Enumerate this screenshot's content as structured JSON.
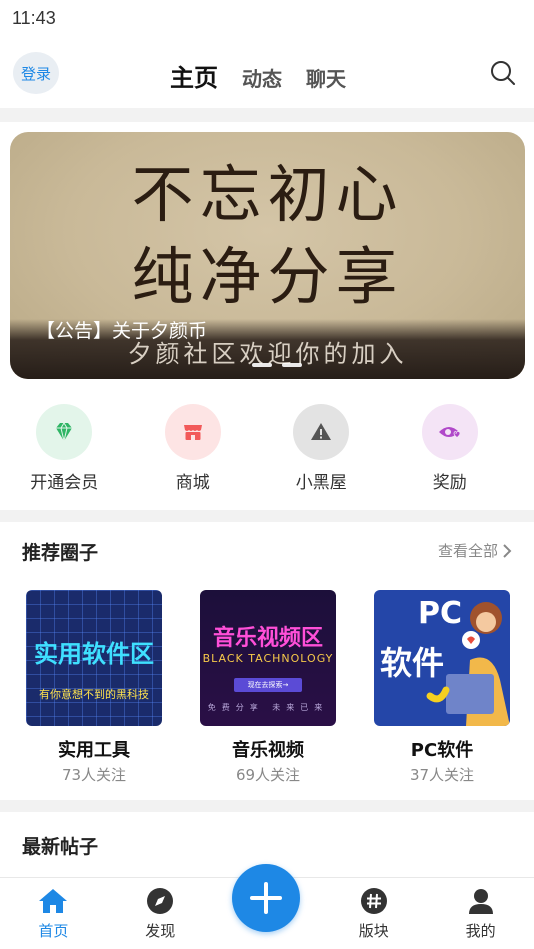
{
  "status_bar": {
    "time": "11:43"
  },
  "header": {
    "login_label": "登录",
    "tabs": [
      {
        "label": "主页",
        "active": true
      },
      {
        "label": "动态",
        "active": false
      },
      {
        "label": "聊天",
        "active": false
      }
    ],
    "search_icon": "search-icon"
  },
  "banner": {
    "line1": "不忘初心",
    "line2": "纯净分享",
    "ribbon_text": "夕颜社区欢迎你的加入",
    "caption": "【公告】关于夕颜币",
    "slide_count": 2
  },
  "shortcuts": [
    {
      "label": "开通会员",
      "icon": "diamond-icon",
      "bg": "#e3f5ea",
      "color": "#2fb565"
    },
    {
      "label": "商城",
      "icon": "store-icon",
      "bg": "#fde4e4",
      "color": "#f25a5a"
    },
    {
      "label": "小黑屋",
      "icon": "warning-icon",
      "bg": "#e3e3e3",
      "color": "#555555"
    },
    {
      "label": "奖励",
      "icon": "eye-heart-icon",
      "bg": "#f4e4f6",
      "color": "#b048c9"
    }
  ],
  "circles": {
    "title": "推荐圈子",
    "view_all": "查看全部",
    "items": [
      {
        "name": "实用工具",
        "followers": "73人关注",
        "thumb_main": "实用软件区",
        "thumb_sub": "有你意想不到的黑科技"
      },
      {
        "name": "音乐视频",
        "followers": "69人关注",
        "thumb_main": "音乐视频区",
        "thumb_sub": "BLACK TACHNOLOGY",
        "thumb_btn": "现在去探索→",
        "thumb_foot": "免费分享 未来已来"
      },
      {
        "name": "PC软件",
        "followers": "37人关注",
        "thumb_pc": "PC",
        "thumb_main": "软件"
      }
    ]
  },
  "posts": {
    "title": "最新帖子"
  },
  "bottom_nav": {
    "items": [
      {
        "label": "首页",
        "icon": "home-icon",
        "active": true
      },
      {
        "label": "发现",
        "icon": "compass-icon",
        "active": false
      },
      {
        "label": "版块",
        "icon": "hash-icon",
        "active": false
      },
      {
        "label": "我的",
        "icon": "user-icon",
        "active": false
      }
    ],
    "fab_icon": "plus-icon"
  },
  "colors": {
    "accent": "#1e88e5"
  }
}
